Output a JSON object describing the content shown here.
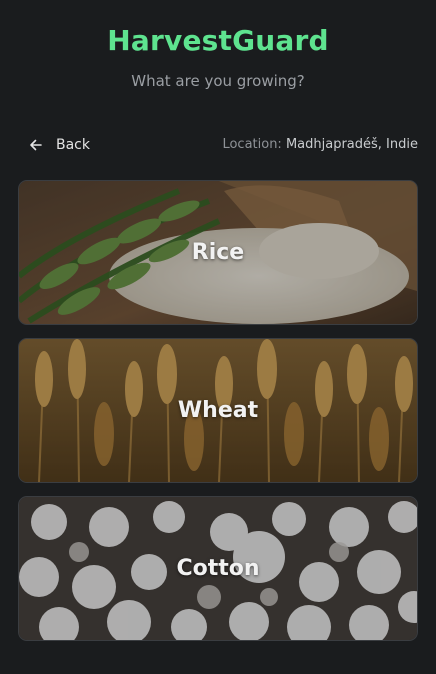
{
  "app": {
    "title": "HarvestGuard",
    "subtitle": "What are you growing?"
  },
  "nav": {
    "back_label": "Back",
    "back_icon": "arrow-left-icon",
    "location_prefix": "Location: ",
    "location_value": "Madhjapradéš, Indie"
  },
  "crops": [
    {
      "label": "Rice"
    },
    {
      "label": "Wheat"
    },
    {
      "label": "Cotton"
    }
  ],
  "colors": {
    "accent": "#5ee38f",
    "background": "#1a1c1e"
  }
}
